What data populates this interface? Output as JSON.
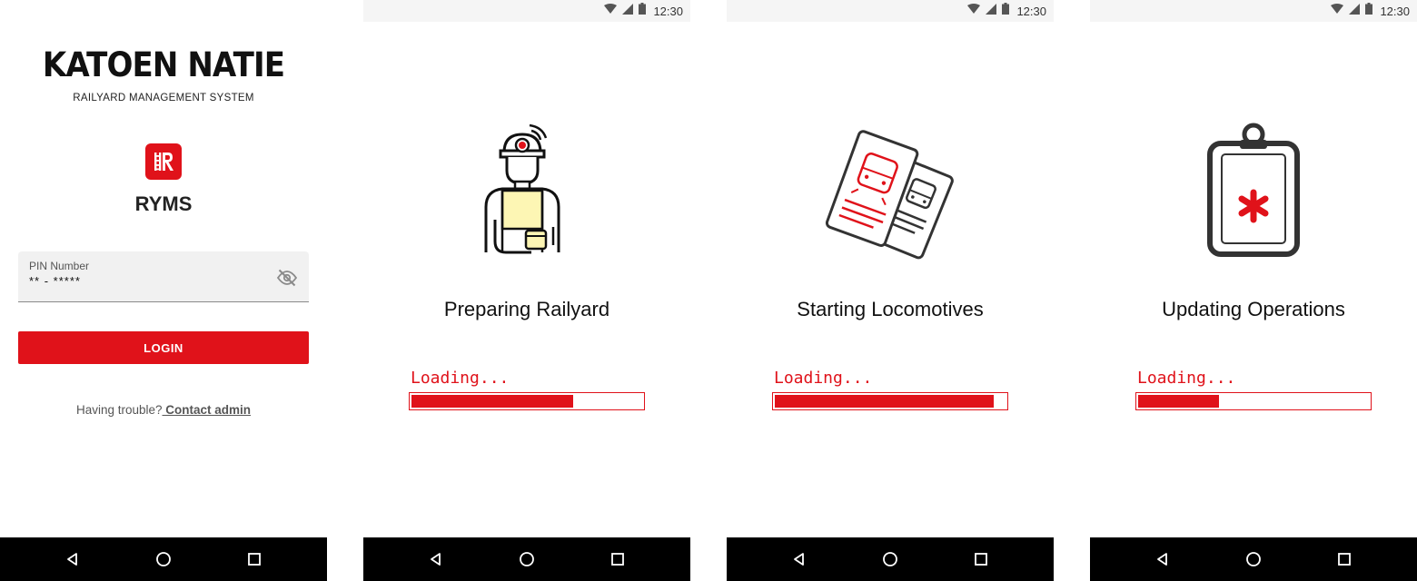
{
  "login_screen": {
    "brand": "KATOEN NATIE",
    "subtitle": "RAILYARD MANAGEMENT SYSTEM",
    "app_icon_letter": "R",
    "app_name": "RYMS",
    "pin_field": {
      "label": "PIN Number",
      "value": "** - *****"
    },
    "login_button": "LOGIN",
    "trouble_text": "Having trouble?",
    "contact_link": " Contact admin"
  },
  "status_bar": {
    "time": "12:30"
  },
  "loading_screens": [
    {
      "title": "Preparing Railyard",
      "loading_label": "Loading...",
      "progress": 0.7,
      "icon": "worker-icon"
    },
    {
      "title": "Starting Locomotives",
      "loading_label": "Loading...",
      "progress": 0.95,
      "icon": "train-tickets-icon"
    },
    {
      "title": "Updating Operations",
      "loading_label": "Loading...",
      "progress": 0.35,
      "icon": "clipboard-icon"
    }
  ],
  "colors": {
    "accent": "#e0121a",
    "dark": "#333333",
    "field_bg": "#f1f1f1",
    "navbar": "#000000"
  }
}
